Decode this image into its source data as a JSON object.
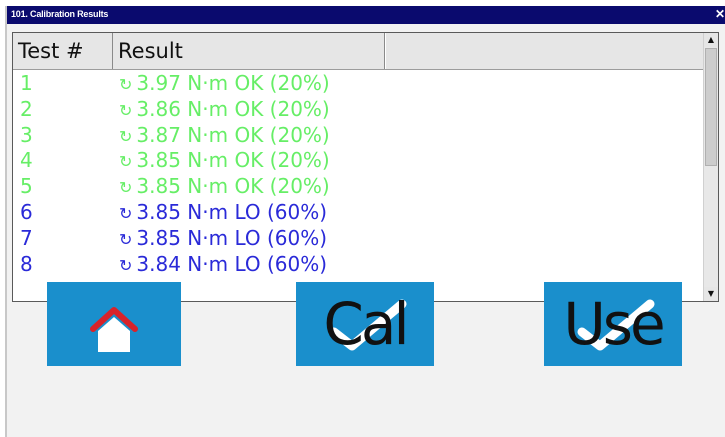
{
  "window": {
    "title": "101. Calibration Results",
    "close_glyph": "✕"
  },
  "table": {
    "columns": [
      "Test #",
      "Result"
    ],
    "rows": [
      {
        "test": "1",
        "result": "3.97 N·m OK (20%)",
        "status": "ok"
      },
      {
        "test": "2",
        "result": "3.86 N·m OK (20%)",
        "status": "ok"
      },
      {
        "test": "3",
        "result": "3.87 N·m OK (20%)",
        "status": "ok"
      },
      {
        "test": "4",
        "result": "3.85 N·m OK (20%)",
        "status": "ok"
      },
      {
        "test": "5",
        "result": "3.85 N·m OK (20%)",
        "status": "ok"
      },
      {
        "test": "6",
        "result": "3.85 N·m LO (60%)",
        "status": "lo"
      },
      {
        "test": "7",
        "result": "3.85 N·m LO (60%)",
        "status": "lo"
      },
      {
        "test": "8",
        "result": "3.84 N·m LO (60%)",
        "status": "lo"
      }
    ],
    "row_icon": "refresh-icon",
    "status_colors": {
      "ok": "#66ee66",
      "lo": "#2a2ad8"
    }
  },
  "buttons": {
    "home": {
      "icon": "home-icon"
    },
    "cal": {
      "label": "Cal",
      "icon": "checkmark-icon"
    },
    "use": {
      "label": "Use",
      "icon": "checkmark-icon"
    }
  },
  "colors": {
    "title_bar": "#0a0a6e",
    "button_bg": "#1a8fcc",
    "home_roof": "#d8232a"
  }
}
